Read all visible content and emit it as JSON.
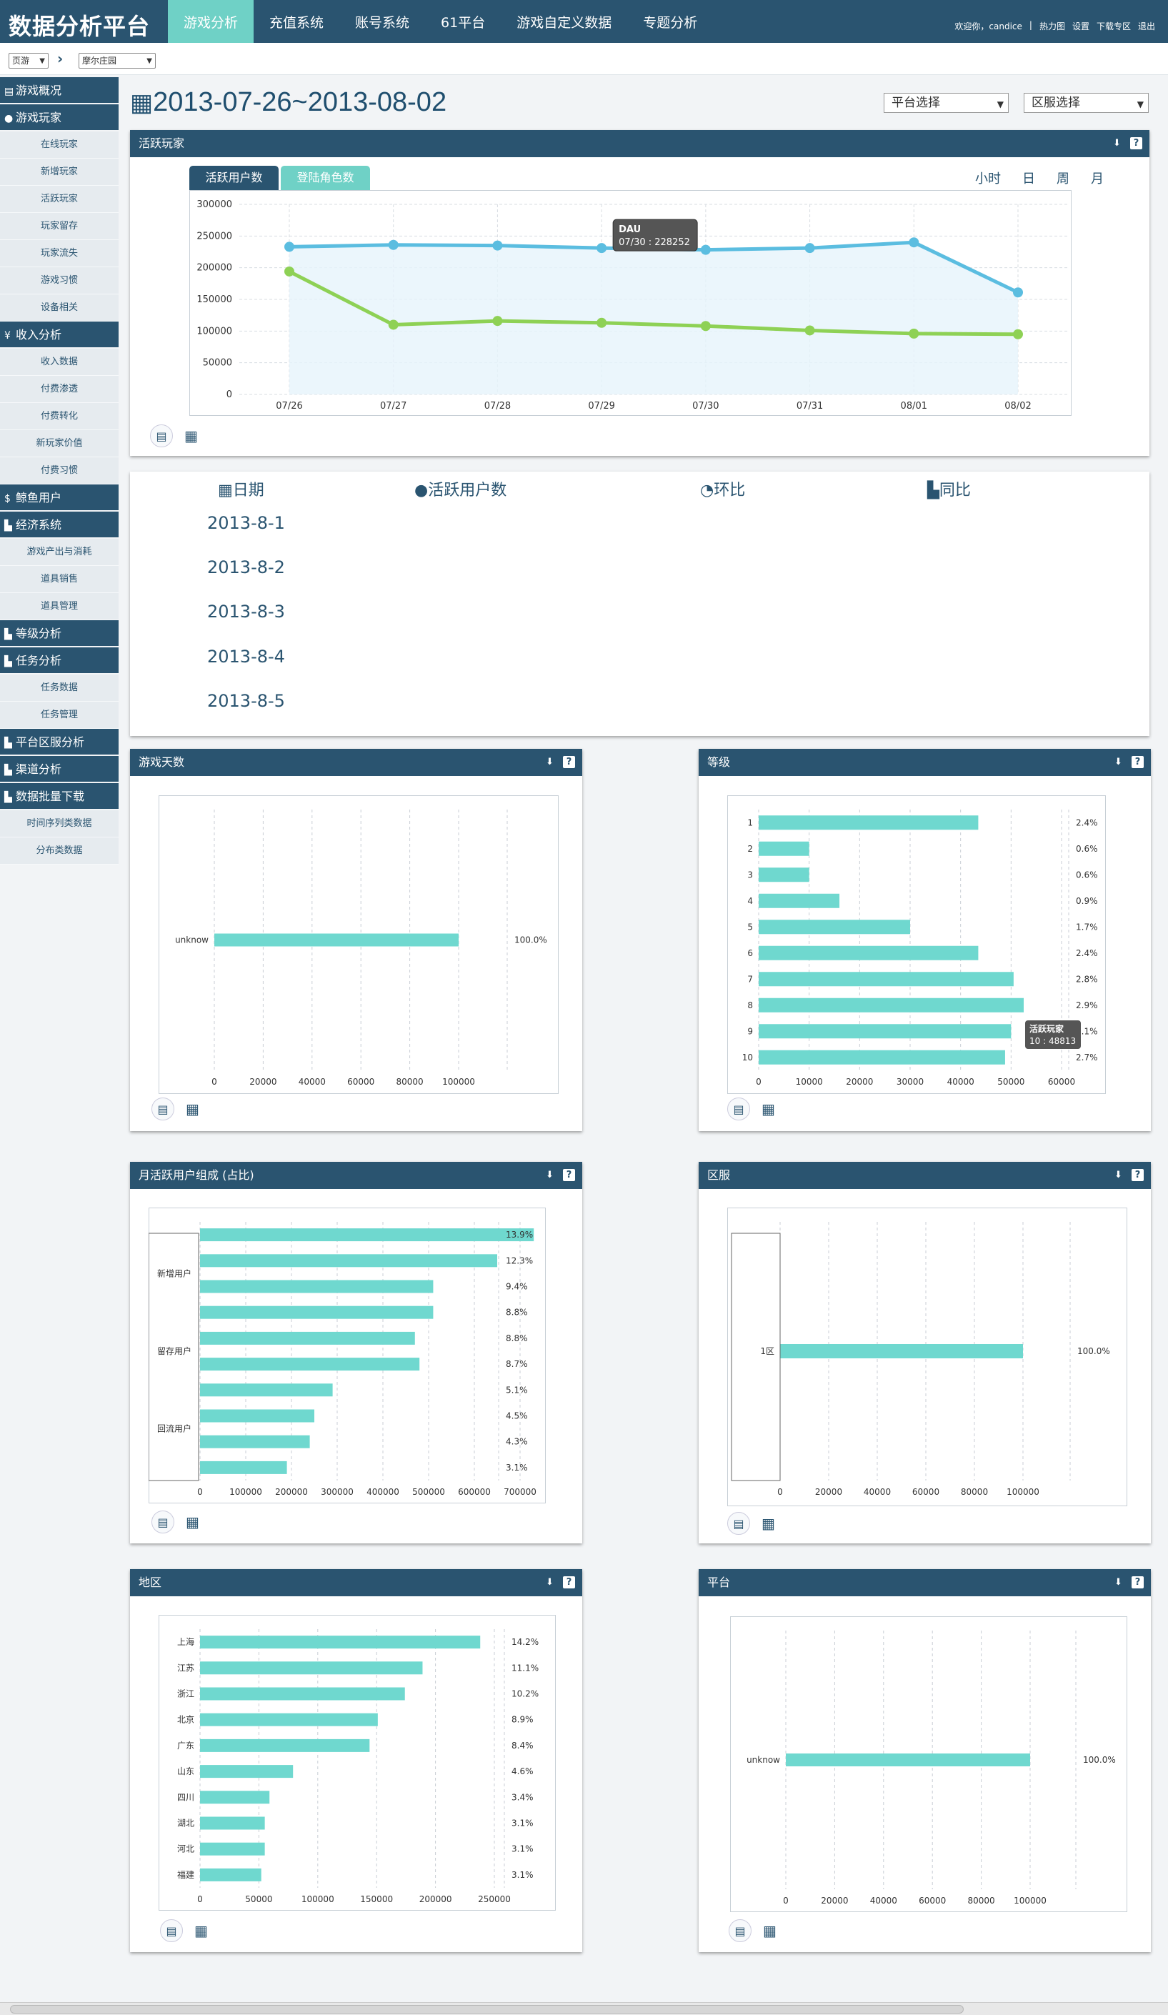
{
  "app": {
    "title": "数据分析平台"
  },
  "nav": {
    "items": [
      "游戏分析",
      "充值系统",
      "账号系统",
      "61平台",
      "游戏自定义数据",
      "专题分析"
    ],
    "active": 0
  },
  "toplinks": {
    "items": [
      "欢迎你，candice",
      "|",
      "热力图",
      "设置",
      "下载专区",
      "退出"
    ]
  },
  "breadcrumb": {
    "first": "页游",
    "second": "摩尔庄园"
  },
  "sidebar": {
    "entries": [
      {
        "type": "section",
        "icon": "book-icon",
        "label": "游戏概况"
      },
      {
        "type": "section",
        "icon": "user-icon",
        "label": "游戏玩家"
      },
      {
        "type": "item",
        "label": "在线玩家"
      },
      {
        "type": "item",
        "label": "新增玩家"
      },
      {
        "type": "item",
        "label": "活跃玩家"
      },
      {
        "type": "item",
        "label": "玩家留存"
      },
      {
        "type": "item",
        "label": "玩家流失"
      },
      {
        "type": "item",
        "label": "游戏习惯"
      },
      {
        "type": "item",
        "label": "设备相关"
      },
      {
        "type": "section",
        "icon": "yen-icon",
        "label": "收入分析"
      },
      {
        "type": "item",
        "label": "收入数据"
      },
      {
        "type": "item",
        "label": "付费渗透"
      },
      {
        "type": "item",
        "label": "付费转化"
      },
      {
        "type": "item",
        "label": "新玩家价值"
      },
      {
        "type": "item",
        "label": "付费习惯"
      },
      {
        "type": "section",
        "icon": "dollar-icon",
        "label": "鲸鱼用户"
      },
      {
        "type": "section",
        "icon": "chart-icon",
        "label": "经济系统"
      },
      {
        "type": "item",
        "label": "游戏产出与消耗"
      },
      {
        "type": "item",
        "label": "道具销售"
      },
      {
        "type": "item",
        "label": "道具管理"
      },
      {
        "type": "section",
        "icon": "chart-icon",
        "label": "等级分析"
      },
      {
        "type": "section",
        "icon": "chart-icon",
        "label": "任务分析"
      },
      {
        "type": "item",
        "label": "任务数据"
      },
      {
        "type": "item",
        "label": "任务管理"
      },
      {
        "type": "section",
        "icon": "chart-icon",
        "label": "平台区服分析"
      },
      {
        "type": "section",
        "icon": "chart-icon",
        "label": "渠道分析"
      },
      {
        "type": "section",
        "icon": "chart-icon",
        "label": "数据批量下载"
      },
      {
        "type": "item",
        "label": "时间序列类数据"
      },
      {
        "type": "item",
        "label": "分布类数据"
      }
    ]
  },
  "header": {
    "date_range": "2013-07-26~2013-08-02",
    "platform_select": "平台选择",
    "server_select": "区服选择"
  },
  "active_panel": {
    "title": "活跃玩家",
    "tab1": "活跃用户数",
    "tab2": "登陆角色数",
    "granularity": [
      "小时",
      "日",
      "周",
      "月"
    ],
    "tooltip_title": "DAU",
    "tooltip_value": "07/30 : 228252"
  },
  "colors": {
    "header": "#2a5470",
    "accent": "#6fd1c6",
    "line_blue": "#5bbde0",
    "line_green": "#8ed155",
    "bar": "#6fd8cf"
  },
  "table": {
    "headers": [
      "日期",
      "活跃用户数",
      "环比",
      "同比"
    ],
    "rows": [
      "2013-8-1",
      "2013-8-2",
      "2013-8-3",
      "2013-8-4",
      "2013-8-5"
    ]
  },
  "panels": {
    "days": "游戏天数",
    "level": "等级",
    "monthly": "月活跃用户组成 (占比)",
    "server": "区服",
    "region": "地区",
    "platform": "平台"
  },
  "level_tooltip": {
    "title": "活跃玩家",
    "value": "10 : 48813"
  },
  "chart_data": [
    {
      "type": "line",
      "x": [
        "07/26",
        "07/27",
        "07/28",
        "07/29",
        "07/30",
        "07/31",
        "08/01",
        "08/02"
      ],
      "series": [
        {
          "name": "DAU",
          "values": [
            233000,
            236000,
            235000,
            231000,
            228252,
            231000,
            240000,
            161000
          ]
        },
        {
          "values": [
            194000,
            110000,
            116000,
            113000,
            108000,
            101000,
            96000,
            95000
          ]
        }
      ],
      "ylim": [
        0,
        300000
      ],
      "yticks": [
        "0",
        "50000",
        "100000",
        "150000",
        "200000",
        "250000",
        "300000"
      ]
    },
    {
      "type": "bar",
      "orientation": "horizontal",
      "categories": [
        "unknow"
      ],
      "values": [
        100000
      ],
      "labels": [
        "100.0%"
      ],
      "xlim": [
        0,
        100000
      ],
      "xticks": [
        "0",
        "20000",
        "40000",
        "60000",
        "80000",
        "100000"
      ]
    },
    {
      "type": "bar",
      "orientation": "horizontal",
      "categories": [
        "1",
        "2",
        "3",
        "4",
        "5",
        "6",
        "7",
        "8",
        "9",
        "10"
      ],
      "values": [
        43500,
        10000,
        10000,
        16000,
        30000,
        43500,
        50500,
        52500,
        50000,
        48813
      ],
      "labels": [
        "2.4%",
        "0.6%",
        "0.6%",
        "0.9%",
        "1.7%",
        "2.4%",
        "2.8%",
        "2.9%",
        "3.1%",
        "2.7%"
      ],
      "xlim": [
        0,
        60000
      ],
      "xticks": [
        "0",
        "10000",
        "20000",
        "30000",
        "40000",
        "50000",
        "60000"
      ]
    },
    {
      "type": "bar",
      "orientation": "horizontal",
      "groups": [
        "新增用户",
        "留存用户",
        "回流用户"
      ],
      "values": [
        730000,
        650000,
        510000,
        510000,
        470000,
        480000,
        290000,
        250000,
        240000,
        190000
      ],
      "labels": [
        "13.9%",
        "12.3%",
        "9.4%",
        "8.8%",
        "8.8%",
        "8.7%",
        "5.1%",
        "4.5%",
        "4.3%",
        "3.1%"
      ],
      "xlim": [
        0,
        700000
      ],
      "xticks": [
        "0",
        "100000",
        "200000",
        "300000",
        "400000",
        "500000",
        "600000",
        "700000"
      ]
    },
    {
      "type": "bar",
      "orientation": "horizontal",
      "categories": [
        "1区"
      ],
      "values": [
        100000
      ],
      "labels": [
        "100.0%"
      ],
      "xlim": [
        0,
        100000
      ],
      "xticks": [
        "0",
        "20000",
        "40000",
        "60000",
        "80000",
        "100000"
      ]
    },
    {
      "type": "bar",
      "orientation": "horizontal",
      "categories": [
        "上海",
        "江苏",
        "浙江",
        "北京",
        "广东",
        "山东",
        "四川",
        "湖北",
        "河北",
        "福建"
      ],
      "values": [
        238000,
        189000,
        174000,
        151000,
        144000,
        79000,
        59000,
        55000,
        55000,
        52000
      ],
      "labels": [
        "14.2%",
        "11.1%",
        "10.2%",
        "8.9%",
        "8.4%",
        "4.6%",
        "3.4%",
        "3.1%",
        "3.1%",
        "3.1%"
      ],
      "xlim": [
        0,
        250000
      ],
      "xticks": [
        "0",
        "50000",
        "100000",
        "150000",
        "200000",
        "250000"
      ]
    },
    {
      "type": "bar",
      "orientation": "horizontal",
      "categories": [
        "unknow"
      ],
      "values": [
        100000
      ],
      "labels": [
        "100.0%"
      ],
      "xlim": [
        0,
        100000
      ],
      "xticks": [
        "0",
        "20000",
        "40000",
        "60000",
        "80000",
        "100000"
      ]
    }
  ]
}
